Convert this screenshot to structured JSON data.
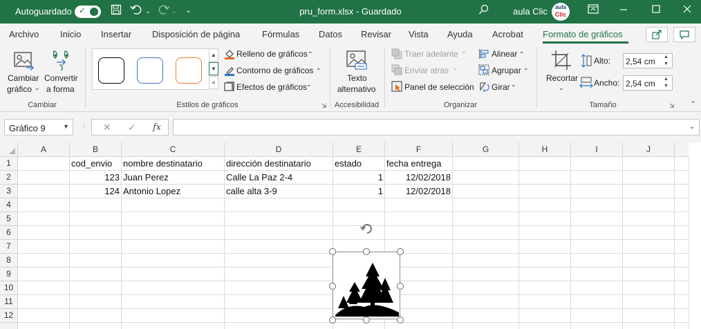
{
  "titlebar": {
    "autosave_label": "Autoguardado",
    "autosave_state": "on",
    "filename": "pru_form.xlsx",
    "separator": "-",
    "save_status": "Guardado",
    "user_name": "aula Clic",
    "avatar_top": "aula",
    "avatar_bottom": "Clic",
    "accent": "#217346"
  },
  "tabs": {
    "items": [
      "Archivo",
      "Inicio",
      "Insertar",
      "Disposición de página",
      "Fórmulas",
      "Datos",
      "Revisar",
      "Vista",
      "Ayuda",
      "Acrobat",
      "Formato de gráficos"
    ],
    "active": "Formato de gráficos"
  },
  "ribbon": {
    "cambiar": {
      "change_graphic_1": "Cambiar",
      "change_graphic_2": "gráfico",
      "convert_shape_1": "Convertir",
      "convert_shape_2": "a forma",
      "group_label": "Cambiar"
    },
    "estilos": {
      "styles": [
        {
          "name": "black-outline",
          "color": "#000000"
        },
        {
          "name": "blue-outline",
          "color": "#4472c4"
        },
        {
          "name": "orange-outline",
          "color": "#ed7d31"
        }
      ],
      "fill_label": "Relleno de gráficos",
      "outline_label": "Contorno de gráficos",
      "effects_label": "Efectos de gráficos",
      "group_label": "Estilos de gráficos"
    },
    "accesibilidad": {
      "alt_text_1": "Texto",
      "alt_text_2": "alternativo",
      "group_label": "Accesibilidad"
    },
    "organizar": {
      "bring_forward": "Traer adelante",
      "send_backward": "Enviar atrás",
      "selection_pane": "Panel de selección",
      "align": "Alinear",
      "group": "Agrupar",
      "rotate": "Girar",
      "group_label": "Organizar"
    },
    "tamano": {
      "crop_label": "Recortar",
      "height_label": "Alto:",
      "height_value": "2,54 cm",
      "width_label": "Ancho:",
      "width_value": "2,54 cm",
      "group_label": "Tamaño"
    }
  },
  "formula_bar": {
    "name_box": "Gráfico 9",
    "fx_label": "fx",
    "formula": ""
  },
  "sheet": {
    "columns": [
      "A",
      "B",
      "C",
      "D",
      "E",
      "F",
      "G",
      "H",
      "I",
      "J"
    ],
    "rows": [
      "1",
      "2",
      "3",
      "4",
      "5",
      "6",
      "7",
      "8",
      "9",
      "10",
      "11",
      "12"
    ],
    "headers": {
      "B": "cod_envio",
      "C": "nombre destinatario",
      "D": "dirección destinatario",
      "E": "estado",
      "F": "fecha entrega"
    },
    "records": [
      {
        "cod": "123",
        "nombre": "Juan Perez",
        "direccion": "Calle La Paz 2-4",
        "estado": "1",
        "fecha": "12/02/2018"
      },
      {
        "cod": "124",
        "nombre": "Antonio Lopez",
        "direccion": "calle alta 3-9",
        "estado": "1",
        "fecha": "12/02/2018"
      }
    ]
  },
  "graphic": {
    "icon": "trees-icon",
    "selected": true
  }
}
